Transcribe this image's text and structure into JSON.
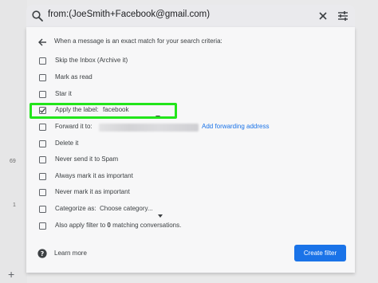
{
  "search": {
    "query": "from:(JoeSmith+Facebook@gmail.com)",
    "icons": {
      "search": "search-icon",
      "close": "close-icon",
      "options": "tune-icon"
    }
  },
  "left_strip": {
    "num_a": "69",
    "num_b": "1",
    "compose_glyph": "+"
  },
  "filter": {
    "header": "When a message is an exact match for your search criteria:",
    "options": {
      "skip_inbox": "Skip the Inbox (Archive it)",
      "mark_read": "Mark as read",
      "star": "Star it",
      "apply_label": "Apply the label:",
      "apply_label_value": "facebook",
      "forward": "Forward it to:",
      "forward_link": "Add forwarding address",
      "delete": "Delete it",
      "never_spam": "Never send it to Spam",
      "always_important": "Always mark it as important",
      "never_important": "Never mark it as important",
      "categorize": "Categorize as:",
      "categorize_value": "Choose category...",
      "also_apply_prefix": "Also apply filter to",
      "also_apply_count": "0",
      "also_apply_suffix": "matching conversations."
    },
    "checked": {
      "apply_label": true
    },
    "learn_more": "Learn more",
    "create_button": "Create filter"
  },
  "colors": {
    "accent": "#1a73e8",
    "highlight": "#22e51a",
    "panel_bg": "#f7f7f8",
    "page_bg": "#e9e9ea"
  }
}
